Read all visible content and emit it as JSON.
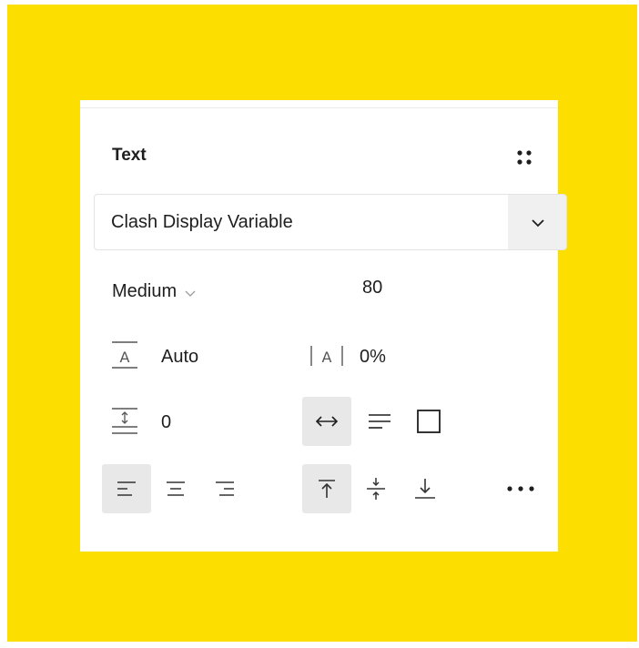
{
  "panel": {
    "section_title": "Text",
    "styles_icon": "four-dots-grid-icon"
  },
  "font": {
    "family": "Clash Display Variable",
    "chevron_icon": "chevron-down-icon"
  },
  "typography": {
    "weight": "Medium",
    "size": "80",
    "line_height": "Auto",
    "letter_spacing": "0%",
    "paragraph_spacing": "0"
  },
  "resizing": {
    "options": [
      "auto-width",
      "auto-height",
      "fixed-size"
    ],
    "selected": "auto-width"
  },
  "alignment": {
    "horizontal": [
      "align-left",
      "align-center",
      "align-right"
    ],
    "horizontal_selected": "align-left",
    "vertical": [
      "align-top",
      "align-middle",
      "align-bottom"
    ],
    "vertical_selected": "align-top"
  },
  "colors": {
    "background": "#fcde00",
    "panel": "#ffffff",
    "active_button": "#e8e8e8",
    "text": "#1e1e1e",
    "icon": "#333333"
  }
}
